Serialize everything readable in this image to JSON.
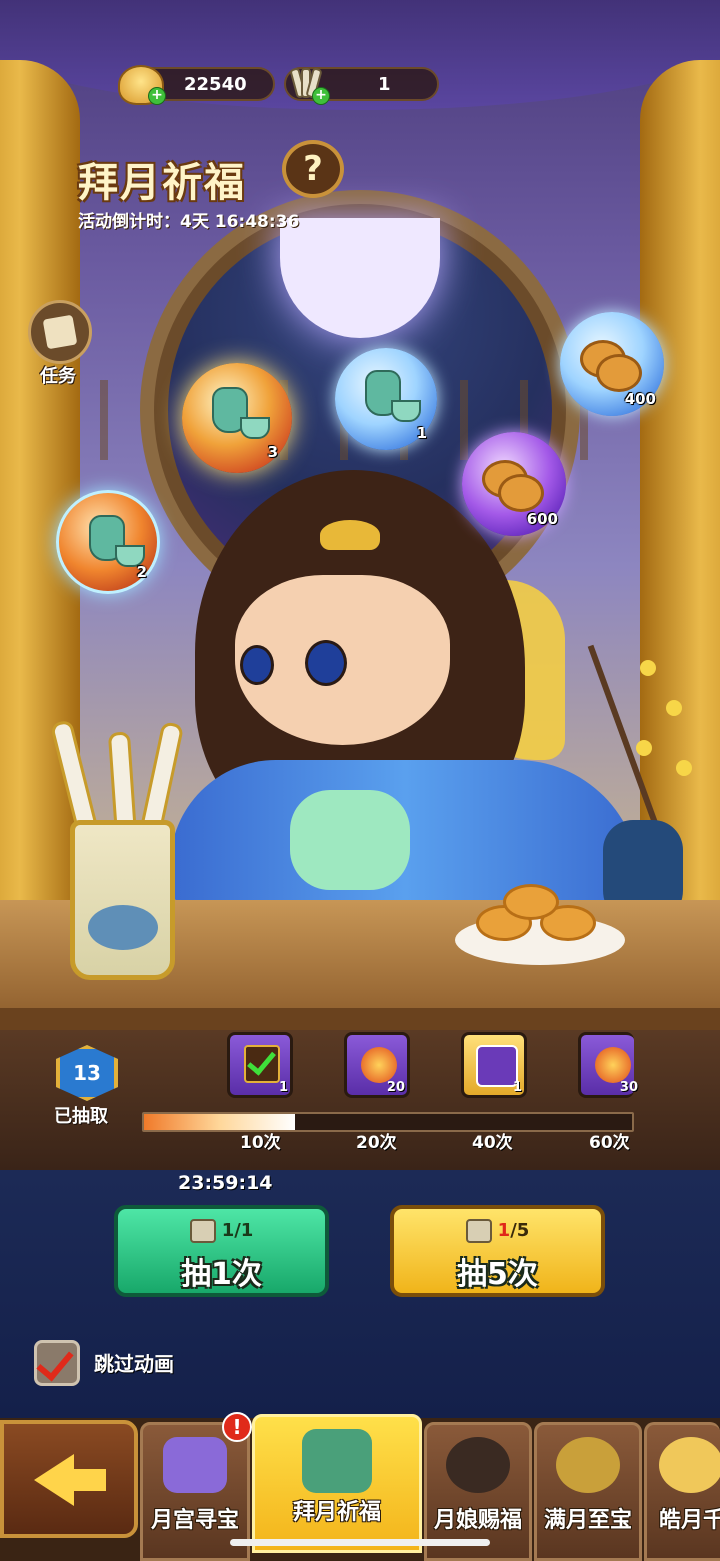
{
  "hud": {
    "ingot_value": "22540",
    "ticket_value": "1",
    "plus": "+"
  },
  "event": {
    "title": "拜月祈福",
    "help_glyph": "?",
    "countdown": "活动倒计时：4天 16:48:36"
  },
  "task": {
    "label": "任务"
  },
  "rewards": [
    {
      "icon": "wine-set-icon",
      "qty": "3"
    },
    {
      "icon": "wine-set-icon",
      "qty": "1"
    },
    {
      "icon": "mooncake-icon",
      "qty": "400"
    },
    {
      "icon": "mooncake-icon",
      "qty": "600"
    },
    {
      "icon": "wine-set-icon",
      "qty": "2"
    }
  ],
  "progress": {
    "drawn_count": "13",
    "drawn_label": "已抽取",
    "fill_fraction": 0.31,
    "milestones": [
      {
        "icon": "chest-check-icon",
        "qty": "1",
        "tick": "10次"
      },
      {
        "icon": "fire-orb-icon",
        "qty": "20",
        "tick": "20次"
      },
      {
        "icon": "avatar-chest-icon",
        "qty": "1",
        "tick": "40次"
      },
      {
        "icon": "fire-orb-icon",
        "qty": "30",
        "tick": "60次"
      }
    ]
  },
  "draw": {
    "free_timer": "23:59:14",
    "single": {
      "cost": "1/1",
      "label": "抽1次"
    },
    "five": {
      "cost_have": "1",
      "cost_need": "/5",
      "label": "抽5次"
    }
  },
  "skip": {
    "label": "跳过动画",
    "checked": true
  },
  "tabs": [
    {
      "label": "月宫寻宝",
      "icon": "treasure-chest-icon",
      "alert": "!"
    },
    {
      "label": "拜月祈福",
      "icon": "fortune-sticks-icon",
      "active": true
    },
    {
      "label": "月娘赐福",
      "icon": "moon-maiden-icon"
    },
    {
      "label": "满月至宝",
      "icon": "golden-toad-icon"
    },
    {
      "label": "皓月千",
      "icon": "moon-rabbit-icon"
    }
  ]
}
